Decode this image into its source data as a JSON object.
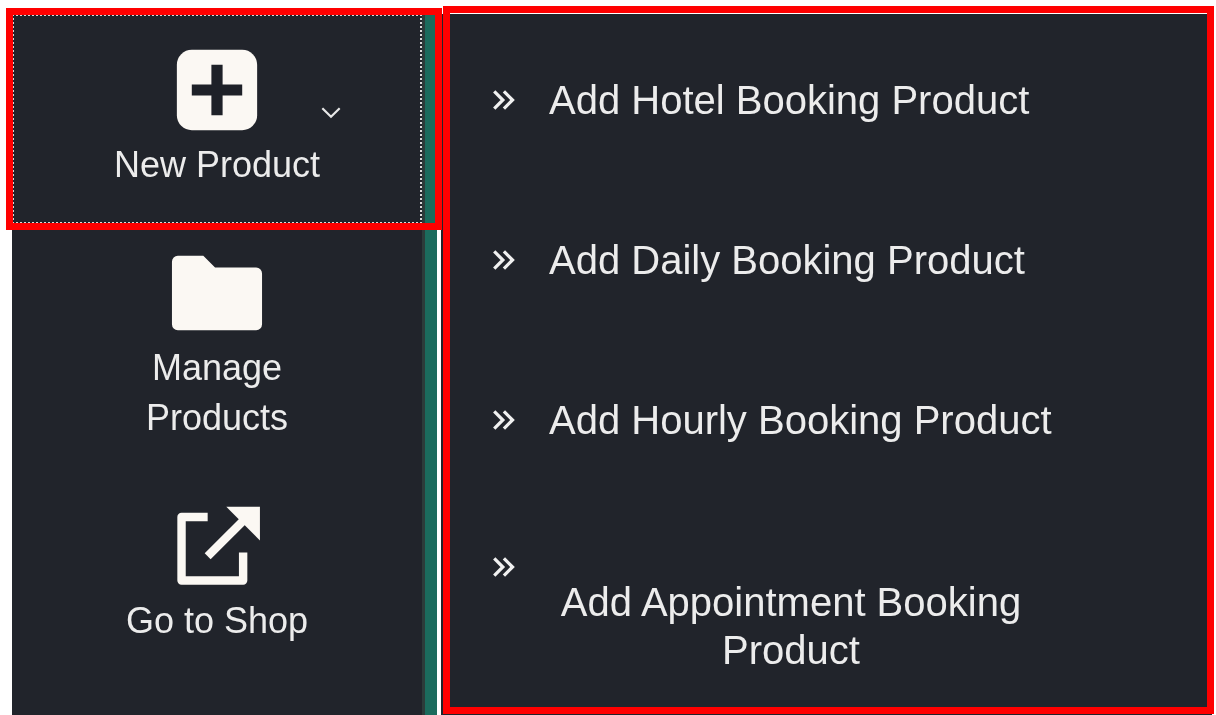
{
  "sidebar": {
    "items": [
      {
        "kind": "plus",
        "label": "New Product",
        "selected": true,
        "expanded": true
      },
      {
        "kind": "folder",
        "label": "Manage Products",
        "selected": false,
        "expanded": false
      },
      {
        "kind": "external",
        "label": "Go to Shop",
        "selected": false,
        "expanded": false
      }
    ]
  },
  "submenu": {
    "items": [
      {
        "label": "Add Hotel Booking Product"
      },
      {
        "label": "Add Daily Booking Product"
      },
      {
        "label": "Add Hourly Booking Product"
      },
      {
        "label": "Add Appointment Booking Product"
      }
    ]
  }
}
